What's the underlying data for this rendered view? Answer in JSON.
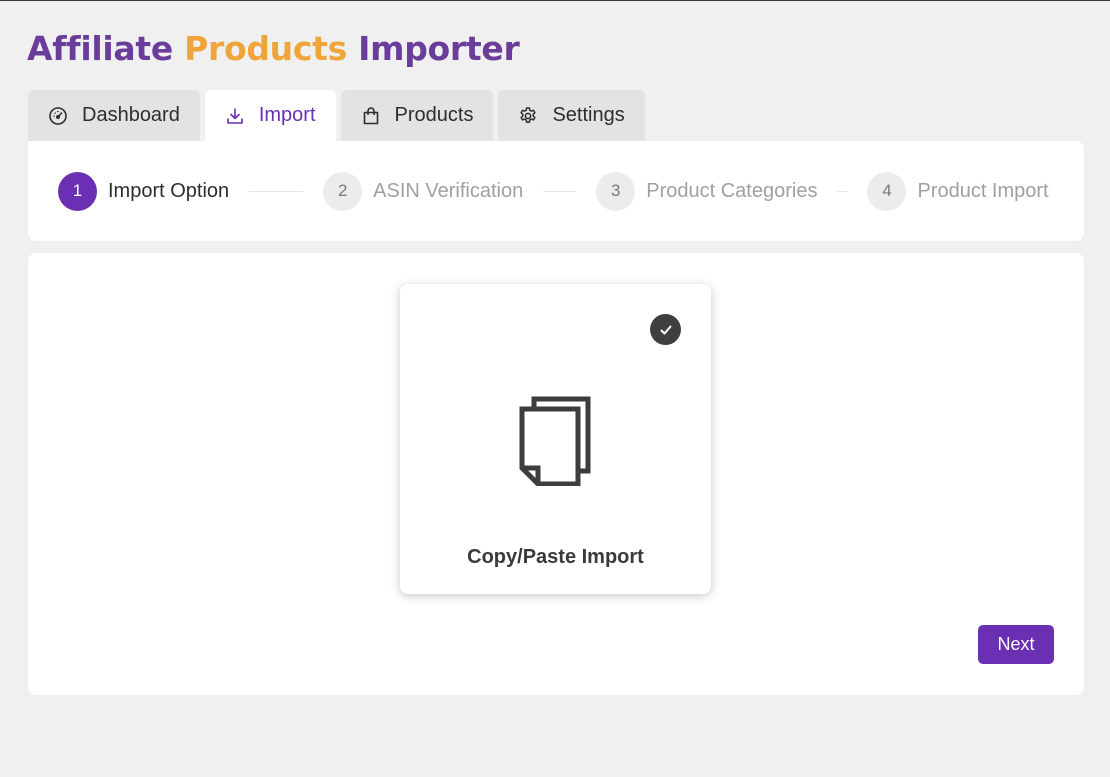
{
  "app": {
    "title_part1": "Affiliate",
    "title_part2": "Products",
    "title_part3": "Importer"
  },
  "tabs": [
    {
      "label": "Dashboard",
      "icon": "gauge-icon",
      "active": false
    },
    {
      "label": "Import",
      "icon": "download-icon",
      "active": true
    },
    {
      "label": "Products",
      "icon": "shopping-bag-icon",
      "active": false
    },
    {
      "label": "Settings",
      "icon": "gear-icon",
      "active": false
    }
  ],
  "stepper": {
    "steps": [
      {
        "number": "1",
        "label": "Import Option",
        "active": true
      },
      {
        "number": "2",
        "label": "ASIN Verification",
        "active": false
      },
      {
        "number": "3",
        "label": "Product Categories",
        "active": false
      },
      {
        "number": "4",
        "label": "Product Import",
        "active": false
      }
    ]
  },
  "import_option": {
    "label": "Copy/Paste Import",
    "icon": "copy-document-icon",
    "selected": true
  },
  "actions": {
    "next_label": "Next"
  },
  "colors": {
    "brand_purple": "#6b2fb3",
    "title_purple": "#6a3d9a",
    "title_orange": "#f0a53a",
    "background": "#f0f0f0"
  }
}
